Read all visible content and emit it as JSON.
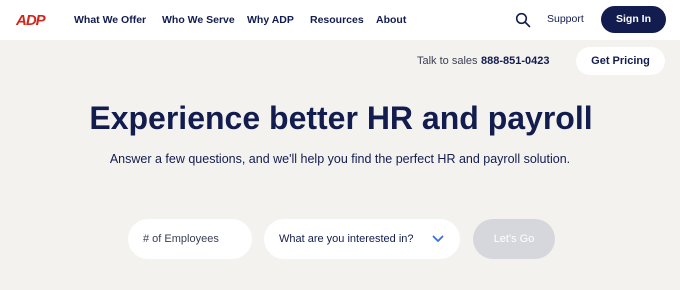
{
  "nav": {
    "logo_text": "ADP",
    "items": [
      {
        "label": "What We Offer"
      },
      {
        "label": "Who We Serve"
      },
      {
        "label": "Why ADP"
      },
      {
        "label": "Resources"
      },
      {
        "label": "About"
      }
    ],
    "search_icon": "search-icon",
    "support_label": "Support",
    "signin_label": "Sign In"
  },
  "sales": {
    "label": "Talk to sales",
    "phone": "888-851-0423",
    "pricing_label": "Get Pricing"
  },
  "hero": {
    "headline": "Experience better HR and payroll",
    "subhead": "Answer a few questions, and we'll help you find the perfect HR and payroll solution."
  },
  "form": {
    "employees_placeholder": "# of Employees",
    "interest_label": "What are you interested in?",
    "interest_icon": "chevron-down-icon",
    "submit_label": "Let's Go"
  },
  "colors": {
    "brand_red": "#d0271d",
    "navy": "#121c4e",
    "background": "#f4f2ef",
    "accent_blue": "#3a6ee8",
    "disabled": "#d6d6dd"
  }
}
